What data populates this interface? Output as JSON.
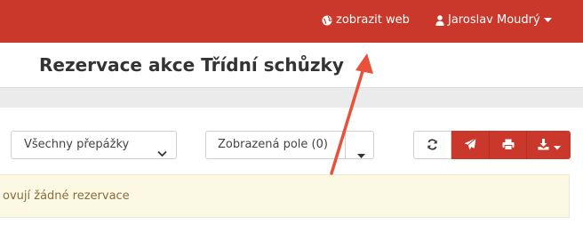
{
  "topbar": {
    "web_link": "zobrazit web",
    "user_name": "Jaroslav Moudrý"
  },
  "page": {
    "title": "Rezervace akce Třídní schůzky"
  },
  "toolbar": {
    "filter_select_value": "Všechny přepážky",
    "fields_button_label": "Zobrazená pole (0)"
  },
  "alert": {
    "text": "ovují žádné rezervace"
  },
  "colors": {
    "brand_red": "#c9382b",
    "alert_bg": "#fbf8e3",
    "annotation_arrow": "#e8523b"
  },
  "icons": {
    "web": "globe-icon",
    "user": "user-icon",
    "refresh": "refresh-icon",
    "send": "paper-plane-icon",
    "print": "print-icon",
    "export": "download-icon"
  }
}
